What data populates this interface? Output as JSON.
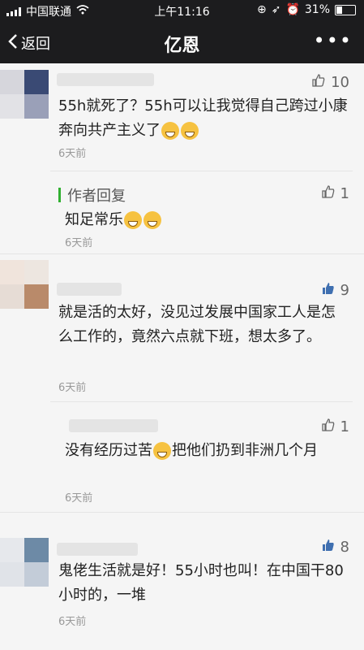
{
  "status": {
    "carrier": "中国联通",
    "time": "上午11:16",
    "battery": "31%",
    "battery_level": 0.31
  },
  "nav": {
    "back_label": "返回",
    "title": "亿恩",
    "more_label": "•••"
  },
  "comments": [
    {
      "likes": "10",
      "text": "55h就死了？55h可以让我觉得自己跨过小康奔向共产主义了",
      "time": "6天前"
    },
    {
      "reply_label": "作者回复",
      "likes": "1",
      "text": "知足常乐",
      "time": "6天前"
    },
    {
      "likes": "9",
      "text": "就是活的太好，没见过发展中国家工人是怎么工作的，竟然六点就下班，想太多了。",
      "time": "6天前"
    },
    {
      "likes": "1",
      "text_part1": "没有经历过苦",
      "text_part2": "把他们扔到非洲几个月",
      "time": "6天前"
    },
    {
      "likes": "8",
      "text": "鬼佬生活就是好！55小时也叫！在中国干80小时的，一堆",
      "time": "6天前"
    }
  ]
}
